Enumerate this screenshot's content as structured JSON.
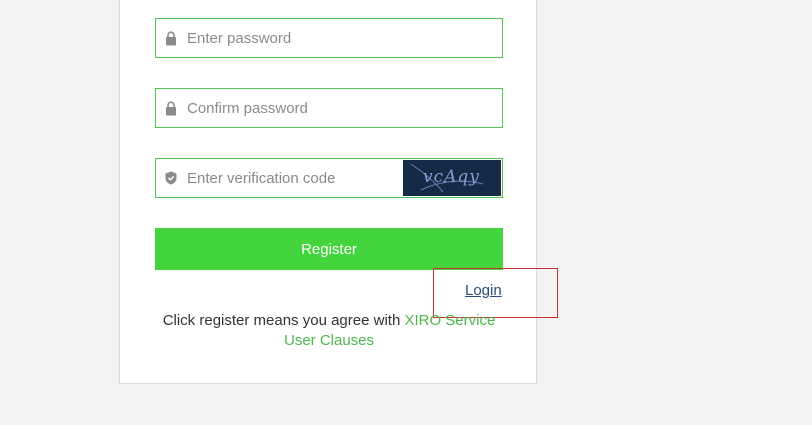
{
  "form": {
    "password": {
      "placeholder": "Enter password",
      "value": ""
    },
    "confirm_password": {
      "placeholder": "Confirm password",
      "value": ""
    },
    "verification": {
      "placeholder": "Enter verification code",
      "value": "",
      "captcha_text": "vcAqy"
    },
    "register_label": "Register"
  },
  "login_label": "Login",
  "terms": {
    "prefix": "Click register means you agree with ",
    "link": "XIRO Service User Clauses"
  },
  "colors": {
    "accent_green": "#43d43e",
    "field_border": "#4cc94c",
    "link_blue": "#2a4e7a",
    "highlight_red": "#c83232"
  }
}
